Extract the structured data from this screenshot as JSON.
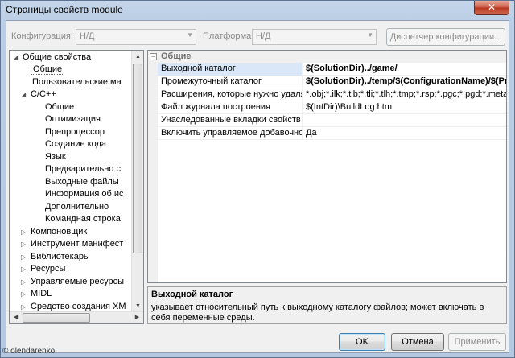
{
  "window": {
    "title": "Страницы свойств module",
    "close_glyph": "✕"
  },
  "config": {
    "configuration_label": "Конфигурация:",
    "configuration_value": "Н/Д",
    "platform_label": "Платформа:",
    "platform_value": "Н/Д",
    "manager_button": "Диспетчер конфигурации..."
  },
  "tree": {
    "items": [
      {
        "label": "Общие свойства",
        "expander": "◢"
      },
      {
        "label": "Общие",
        "expander": ""
      },
      {
        "label": "Пользовательские ма",
        "expander": ""
      },
      {
        "label": "C/C++",
        "expander": "◢"
      },
      {
        "label": "Общие",
        "expander": ""
      },
      {
        "label": "Оптимизация",
        "expander": ""
      },
      {
        "label": "Препроцессор",
        "expander": ""
      },
      {
        "label": "Создание кода",
        "expander": ""
      },
      {
        "label": "Язык",
        "expander": ""
      },
      {
        "label": "Предварительно с",
        "expander": ""
      },
      {
        "label": "Выходные файлы",
        "expander": ""
      },
      {
        "label": "Информация об ис",
        "expander": ""
      },
      {
        "label": "Дополнительно",
        "expander": ""
      },
      {
        "label": "Командная строка",
        "expander": ""
      },
      {
        "label": "Компоновщик",
        "expander": "▷"
      },
      {
        "label": "Инструмент манифест",
        "expander": "▷"
      },
      {
        "label": "Библиотекарь",
        "expander": "▷"
      },
      {
        "label": "Ресурсы",
        "expander": "▷"
      },
      {
        "label": "Управляемые ресурсы",
        "expander": "▷"
      },
      {
        "label": "MIDL",
        "expander": "▷"
      },
      {
        "label": "Средство создания XM",
        "expander": "▷"
      }
    ]
  },
  "grid": {
    "category_toggle": "−",
    "category": "Общие",
    "rows": [
      {
        "name": "Выходной каталог",
        "value": "$(SolutionDir)../game/"
      },
      {
        "name": "Промежуточный каталог",
        "value": "$(SolutionDir)../temp/$(ConfigurationName)/$(Proje"
      },
      {
        "name": "Расширения, которые нужно удалять",
        "value": "*.obj;*.ilk;*.tlb;*.tli;*.tlh;*.tmp;*.rsp;*.pgc;*.pgd;*.meta;$("
      },
      {
        "name": "Файл журнала построения",
        "value": "$(IntDir)\\BuildLog.htm"
      },
      {
        "name": "Унаследованные вкладки свойств пр",
        "value": ""
      },
      {
        "name": "Включить управляемое добавочное",
        "value": "Да"
      }
    ]
  },
  "description": {
    "title": "Выходной каталог",
    "text": "указывает относительный путь к выходному каталогу файлов; может включать в себя переменные среды."
  },
  "buttons": {
    "ok": "OK",
    "cancel": "Отмена",
    "apply": "Применить"
  },
  "watermark": "© olendarenko"
}
